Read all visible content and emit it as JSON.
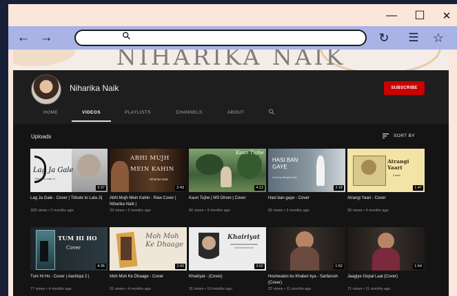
{
  "window": {
    "controls": {
      "minimize_glyph": "—",
      "maximize_glyph": "☐",
      "close_glyph": "✕"
    }
  },
  "browser": {
    "back_glyph": "←",
    "forward_glyph": "→",
    "search_glyph": "⚲",
    "reload_glyph": "↻",
    "menu_glyph": "☰",
    "bookmark_glyph": "☆"
  },
  "channel": {
    "banner_text": "NIHARIKA NAIK",
    "name": "Niharika Naik",
    "subscribe_label": "SUBSCRIBE",
    "tabs": [
      "HOME",
      "VIDEOS",
      "PLAYLISTS",
      "CHANNELS",
      "ABOUT"
    ],
    "active_tab": "VIDEOS",
    "search_glyph": "⚲"
  },
  "uploads": {
    "section_title": "Uploads",
    "sort_label": "SORT BY",
    "videos": [
      {
        "title": "Lag Ja Gale - Cover | Tribute to Lata Ji|",
        "meta": "328 views • 2 months ago",
        "duration": "3:37",
        "thumb_text": "Lag Ja Gale",
        "thumb_subtext": "Tribute to Lata Ji",
        "color": "#e8e8e8"
      },
      {
        "title": "Abhi Mujh Mein Kahin - Raw Cover | Niharika Naik |",
        "meta": "29 views • 2 months ago",
        "duration": "2:43",
        "thumb_text": "ABHI MUJH MEIN KAHIN",
        "thumb_subtext": "Niharika Naik",
        "color": "#3a2418"
      },
      {
        "title": "Kaun Tujhe | MS Dhoni | Cover",
        "meta": "56 views • 3 months ago",
        "duration": "4:13",
        "thumb_text": "Kaun Tujhe",
        "thumb_subtext": "",
        "color": "#3f5f3a"
      },
      {
        "title": "Hasi ban gaye - Cover",
        "meta": "65 views • 3 months ago",
        "duration": "3:18",
        "thumb_text": "HASI BAN GAYE",
        "thumb_subtext": "Cover by Niharika Naik",
        "color": "#6c7a86"
      },
      {
        "title": "Atrangi Yaari - Cover",
        "meta": "30 views • 4 months ago",
        "duration": "1:47",
        "thumb_text": "Atrangi Yaari",
        "thumb_subtext": "Cover",
        "color": "#f2e4a6"
      },
      {
        "title": "Tum Hi Ho - Cover | Aashiqui 2 |",
        "meta": "77 views • 4 months ago",
        "duration": "4:35",
        "thumb_text": "TUM HI HO",
        "thumb_subtext": "Cover",
        "color": "#1f2a2e"
      },
      {
        "title": "Moh Moh Ke Dhaage - Cover",
        "meta": "31 views • 4 months ago",
        "duration": "2:43",
        "thumb_text": "Moh Moh Ke Dhaage",
        "thumb_subtext": "",
        "color": "#efe6d8"
      },
      {
        "title": "Khairiyat - (Cover)",
        "meta": "31 views • 10 months ago",
        "duration": "3:02",
        "thumb_text": "Khairiyat",
        "thumb_subtext": "",
        "color": "#ececec"
      },
      {
        "title": "Hoshwalon ko Khaber kya - Sarfarosh (Cover)",
        "meta": "22 views • 11 months ago",
        "duration": "1:52",
        "thumb_text": "",
        "thumb_subtext": "",
        "color": "#2a2421"
      },
      {
        "title": "Jaagiye Gopal Laal (Cover)",
        "meta": "71 views • 11 months ago",
        "duration": "1:54",
        "thumb_text": "",
        "thumb_subtext": "",
        "color": "#2b2623"
      }
    ]
  }
}
